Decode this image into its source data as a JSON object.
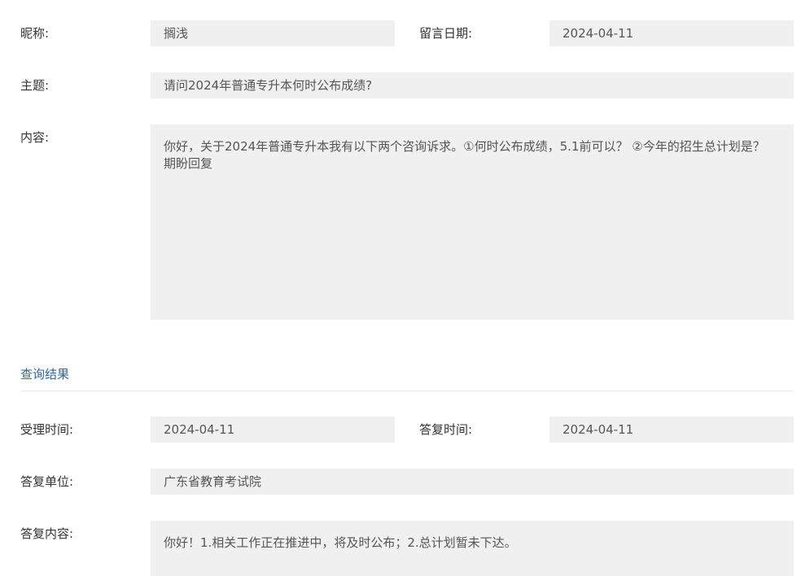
{
  "inquiry": {
    "nickname_label": "昵称:",
    "nickname_value": "搁浅",
    "date_label": "留言日期:",
    "date_value": "2024-04-11",
    "subject_label": "主题:",
    "subject_value": "请问2024年普通专升本何时公布成绩?",
    "content_label": "内容:",
    "content_value": "你好，关于2024年普通专升本我有以下两个咨询诉求。①何时公布成绩，5.1前可以？ ②今年的招生总计划是？ 期盼回复"
  },
  "result": {
    "section_title": "查询结果",
    "accept_time_label": "受理时间:",
    "accept_time_value": "2024-04-11",
    "reply_time_label": "答复时间:",
    "reply_time_value": "2024-04-11",
    "reply_unit_label": "答复单位:",
    "reply_unit_value": "广东省教育考试院",
    "reply_content_label": "答复内容:",
    "reply_content_value": "你好！1.相关工作正在推进中，将及时公布；2.总计划暂未下达。"
  },
  "colors": {
    "field_background": "#f0f0f0",
    "section_title": "#336699",
    "divider": "#e9e9e9"
  }
}
